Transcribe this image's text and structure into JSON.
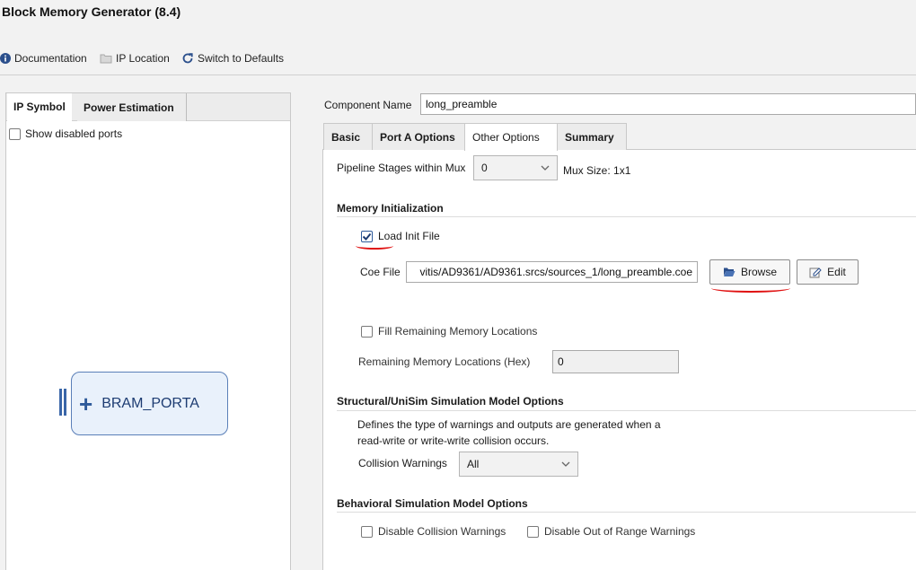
{
  "window": {
    "title": "Block Memory Generator (8.4)"
  },
  "toolbar": {
    "documentation": "Documentation",
    "ip_location": "IP Location",
    "switch_defaults": "Switch to Defaults"
  },
  "left": {
    "tabs": [
      "IP Symbol",
      "Power Estimation"
    ],
    "show_disabled_ports": "Show disabled ports",
    "symbol_label": "BRAM_PORTA"
  },
  "component": {
    "label": "Component Name",
    "value": "long_preamble"
  },
  "tabs": [
    "Basic",
    "Port A Options",
    "Other Options",
    "Summary"
  ],
  "pipeline": {
    "label": "Pipeline Stages within Mux",
    "value": "0",
    "mux_size": "Mux Size: 1x1"
  },
  "memory_init": {
    "heading": "Memory Initialization",
    "load_init_file": "Load Init File",
    "load_init_checked": true,
    "coe_label": "Coe File",
    "coe_value": "vitis/AD9361/AD9361.srcs/sources_1/long_preamble.coe",
    "browse": "Browse",
    "edit": "Edit",
    "fill_remaining": "Fill Remaining Memory Locations",
    "remaining_label": "Remaining Memory Locations (Hex)",
    "remaining_value": "0"
  },
  "structural": {
    "heading": "Structural/UniSim Simulation Model Options",
    "desc_line1": "Defines the type of warnings and outputs are generated when a",
    "desc_line2": "read-write or write-write collision occurs.",
    "collision_label": "Collision Warnings",
    "collision_value": "All"
  },
  "behavioral": {
    "heading": "Behavioral Simulation Model Options",
    "disable_collision": "Disable Collision Warnings",
    "disable_out_of_range": "Disable Out of Range Warnings"
  },
  "colors": {
    "annotation": "#e01010",
    "accent": "#2e5a9a"
  }
}
